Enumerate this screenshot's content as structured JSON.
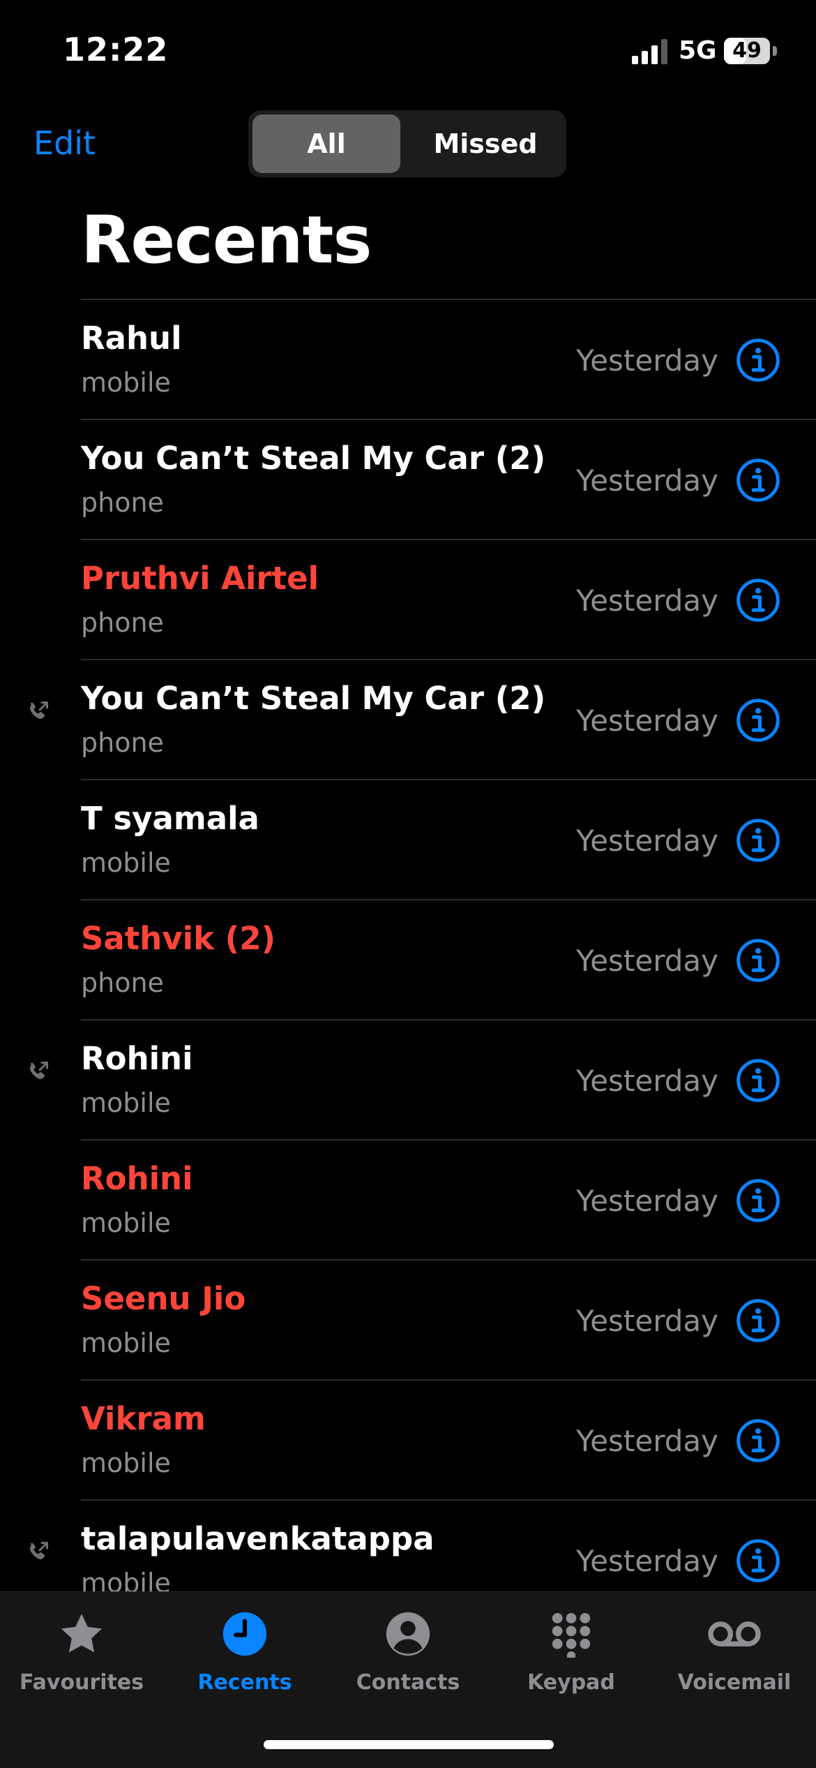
{
  "status_bar": {
    "time": "12:22",
    "network": "5G",
    "battery": "49",
    "battery_level": 0.49
  },
  "nav": {
    "edit_label": "Edit",
    "segments": [
      "All",
      "Missed"
    ],
    "selected_segment": "All"
  },
  "title": "Recents",
  "colors": {
    "accent": "#0a84ff",
    "missed": "#ff453a",
    "secondary_text": "#8e8e93"
  },
  "calls": [
    {
      "name": "Rahul",
      "type": "mobile",
      "date": "Yesterday",
      "missed": false,
      "outgoing": false
    },
    {
      "name": "You Can’t Steal My Car  (2)",
      "type": "phone",
      "date": "Yesterday",
      "missed": false,
      "outgoing": false
    },
    {
      "name": "Pruthvi Airtel",
      "type": "phone",
      "date": "Yesterday",
      "missed": true,
      "outgoing": false
    },
    {
      "name": "You Can’t Steal My Car  (2)",
      "type": "phone",
      "date": "Yesterday",
      "missed": false,
      "outgoing": true
    },
    {
      "name": "T syamala",
      "type": "mobile",
      "date": "Yesterday",
      "missed": false,
      "outgoing": false
    },
    {
      "name": "Sathvik (2)",
      "type": "phone",
      "date": "Yesterday",
      "missed": true,
      "outgoing": false
    },
    {
      "name": "Rohini",
      "type": "mobile",
      "date": "Yesterday",
      "missed": false,
      "outgoing": true
    },
    {
      "name": "Rohini",
      "type": "mobile",
      "date": "Yesterday",
      "missed": true,
      "outgoing": false
    },
    {
      "name": "Seenu Jio",
      "type": "mobile",
      "date": "Yesterday",
      "missed": true,
      "outgoing": false
    },
    {
      "name": "Vikram",
      "type": "mobile",
      "date": "Yesterday",
      "missed": true,
      "outgoing": false
    },
    {
      "name": "talapulavenkatappa",
      "type": "mobile",
      "date": "Yesterday",
      "missed": false,
      "outgoing": true
    }
  ],
  "tabbar": {
    "tabs": [
      {
        "label": "Favourites",
        "icon": "star-icon"
      },
      {
        "label": "Recents",
        "icon": "clock-icon"
      },
      {
        "label": "Contacts",
        "icon": "person-icon"
      },
      {
        "label": "Keypad",
        "icon": "keypad-icon"
      },
      {
        "label": "Voicemail",
        "icon": "voicemail-icon"
      }
    ],
    "active": "Recents"
  }
}
